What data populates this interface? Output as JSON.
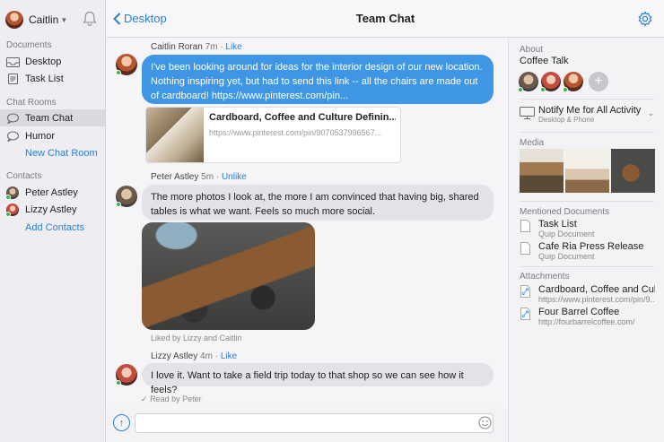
{
  "sidebar": {
    "user_name": "Caitlin",
    "sections": {
      "documents": "Documents",
      "chat_rooms": "Chat Rooms",
      "contacts": "Contacts"
    },
    "documents": [
      {
        "label": "Desktop",
        "icon": "inbox-icon"
      },
      {
        "label": "Task List",
        "icon": "document-icon"
      }
    ],
    "chat_rooms": [
      {
        "label": "Team Chat",
        "icon": "chat-bubble-icon",
        "active": true
      },
      {
        "label": "Humor",
        "icon": "chat-bubble-icon",
        "active": false
      }
    ],
    "new_chat_room": "New Chat Room",
    "contacts": [
      {
        "label": "Peter Astley"
      },
      {
        "label": "Lizzy Astley"
      }
    ],
    "add_contacts": "Add Contacts"
  },
  "topbar": {
    "back_label": "Desktop",
    "title": "Team Chat"
  },
  "messages": [
    {
      "author": "Caitlin Roran",
      "time": "7m",
      "action": "Like",
      "text": "I've been looking around for ideas for the interior design of our new location. Nothing inspiring yet, but had to send this link -- all the chairs are made out of cardboard! https://www.pinterest.com/pin...",
      "link_card": {
        "title": "Cardboard, Coffee and Culture Definin...",
        "url": "https://www.pinterest.com/pin/9070537996567..."
      }
    },
    {
      "author": "Peter Astley",
      "time": "5m",
      "action": "Unlike",
      "text": "The more photos I look at, the more I am convinced that having big, shared tables is what we want. Feels so much more social.",
      "liked_by": "Liked by Lizzy and Caitlin"
    },
    {
      "author": "Lizzy Astley",
      "time": "4m",
      "action": "Like",
      "text": "I love it. Want to take a field trip today to that shop so we can see how it feels?",
      "read_by": "Read by Peter"
    }
  ],
  "composer": {
    "placeholder": ""
  },
  "right_panel": {
    "about_label": "About",
    "about_title": "Coffee Talk",
    "add_member": "+",
    "notify_title": "Notify Me for All Activity",
    "notify_sub": "Desktop & Phone",
    "media_label": "Media",
    "mentioned_label": "Mentioned Documents",
    "mentioned": [
      {
        "title": "Task List",
        "sub": "Quip Document"
      },
      {
        "title": "Cafe Ria Press Release",
        "sub": "Quip Document"
      }
    ],
    "attachments_label": "Attachments",
    "attachments": [
      {
        "title": "Cardboard, Coffee and Cul...",
        "sub": "https://www.pinterest.com/pin/9..."
      },
      {
        "title": "Four Barrel Coffee",
        "sub": "http://fourbarrelcoffee.com/"
      }
    ]
  },
  "colors": {
    "accent": "#2a7fd4",
    "bubble_blue": "#3e96e4",
    "online": "#3cb44b"
  }
}
